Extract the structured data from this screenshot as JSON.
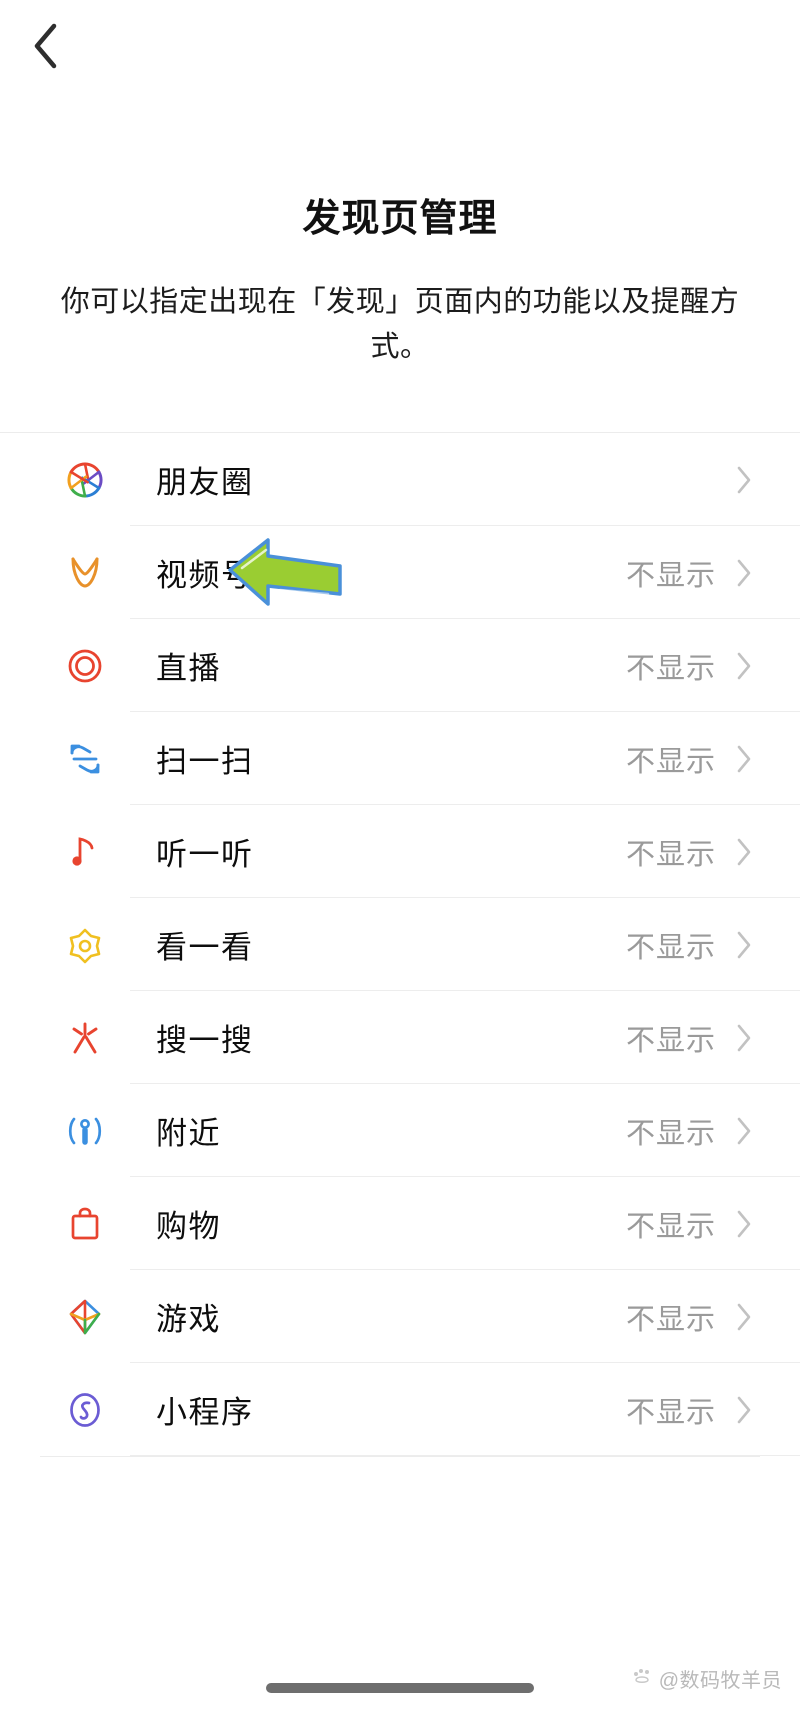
{
  "navbar": {
    "back_icon": "chevron-left-icon"
  },
  "header": {
    "title": "发现页管理",
    "subtitle": "你可以指定出现在「发现」页面内的功能以及提醒方式。"
  },
  "list": {
    "chevron_icon": "chevron-right-icon",
    "rows": [
      {
        "label": "朋友圈",
        "value": "",
        "icon": "moments-icon"
      },
      {
        "label": "视频号",
        "value": "不显示",
        "icon": "channels-icon"
      },
      {
        "label": "直播",
        "value": "不显示",
        "icon": "live-icon"
      },
      {
        "label": "扫一扫",
        "value": "不显示",
        "icon": "scan-icon"
      },
      {
        "label": "听一听",
        "value": "不显示",
        "icon": "listen-music-note-icon"
      },
      {
        "label": "看一看",
        "value": "不显示",
        "icon": "top-stories-flower-icon"
      },
      {
        "label": "搜一搜",
        "value": "不显示",
        "icon": "search-sparkle-icon"
      },
      {
        "label": "附近",
        "value": "不显示",
        "icon": "nearby-person-icon"
      },
      {
        "label": "购物",
        "value": "不显示",
        "icon": "shopping-bag-icon"
      },
      {
        "label": "游戏",
        "value": "不显示",
        "icon": "games-diamond-icon"
      },
      {
        "label": "小程序",
        "value": "不显示",
        "icon": "mini-programs-icon"
      }
    ]
  },
  "annotation": {
    "arrow_icon": "green-pointer-arrow-icon",
    "arrow_fill": "#9ACD32",
    "arrow_stroke": "#4A90D9",
    "target_row_label": "视频号"
  },
  "footer": {
    "watermark_text": "@数码牧羊员",
    "watermark_logo_icon": "paw-logo-icon"
  },
  "colors": {
    "background": "#ffffff",
    "title_text": "#111111",
    "label_text": "#0d0d0d",
    "value_text": "#9a9a9a",
    "divider": "#ededed",
    "chevron": "#c2c2c2",
    "home_indicator": "#6e6e6e"
  }
}
